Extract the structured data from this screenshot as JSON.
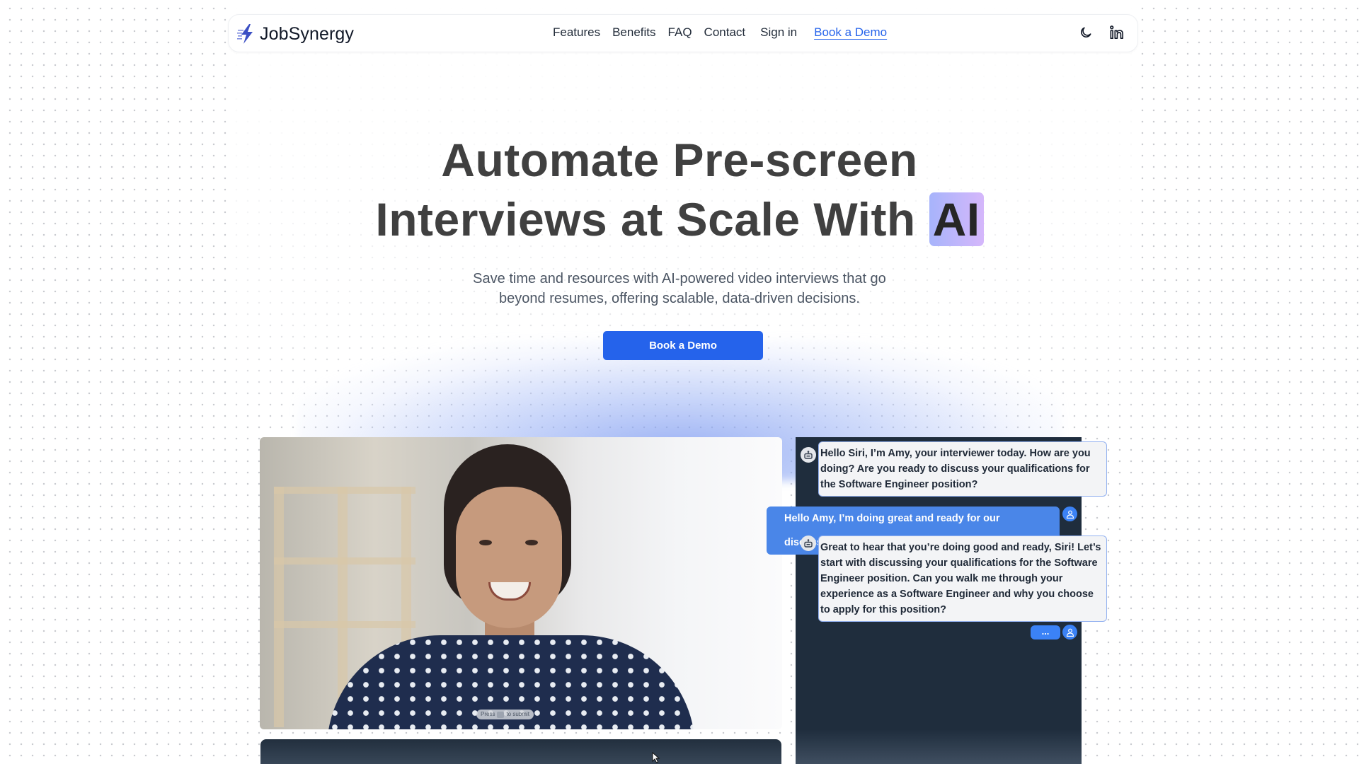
{
  "nav": {
    "brand": "JobSynergy",
    "links": [
      {
        "label": "Features"
      },
      {
        "label": "Benefits"
      },
      {
        "label": "FAQ"
      },
      {
        "label": "Contact"
      }
    ],
    "signin_label": "Sign in",
    "demo_link_label": "Book a Demo",
    "icons": [
      "moon-icon",
      "linkedin-icon"
    ]
  },
  "hero": {
    "title_line1": "Automate Pre-screen",
    "title_line2": "Interviews at Scale With",
    "title_highlight": "AI",
    "subtitle_line1": "Save time and resources with AI-powered video interviews that go",
    "subtitle_line2": "beyond resumes, offering scalable, data-driven decisions.",
    "cta_label": "Book a Demo"
  },
  "demo": {
    "video_hint_before": "Press",
    "video_hint_after": "to submit",
    "chat": [
      {
        "role": "bot",
        "text": "Hello Siri, I’m Amy, your interviewer today. How are you doing? Are you ready to discuss your qualifications for the Software Engineer position?"
      },
      {
        "role": "user",
        "text": "Hello Amy, I’m doing great and ready for our discussion."
      },
      {
        "role": "bot",
        "text": "Great to hear that you’re doing good and ready, Siri! Let’s start with discussing your qualifications for the Software Engineer position. Can you walk me through your experience as a Software Engineer and why you choose to apply for this position?"
      },
      {
        "role": "user",
        "text": "..."
      }
    ]
  },
  "colors": {
    "accent": "#2563eb",
    "user_bubble": "#4a86e8",
    "chat_bg": "#1f2d3d",
    "ai_gradient_start": "#a7b4fb",
    "ai_gradient_end": "#d5b7fb"
  }
}
